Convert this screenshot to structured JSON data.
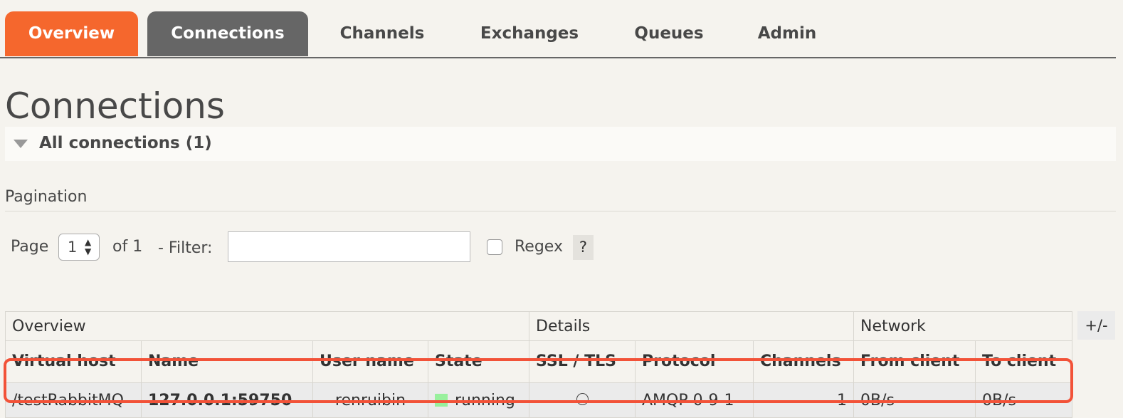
{
  "tabs": [
    "Overview",
    "Connections",
    "Channels",
    "Exchanges",
    "Queues",
    "Admin"
  ],
  "page_title": "Connections",
  "section_title": "All connections (1)",
  "pagination": {
    "label": "Pagination",
    "page_label": "Page",
    "page_value": "1",
    "of_label": "of 1",
    "filter_label": "- Filter:",
    "filter_value": "",
    "regex_label": "Regex",
    "help": "?"
  },
  "table": {
    "groups": [
      "Overview",
      "Details",
      "Network"
    ],
    "headers": [
      "Virtual host",
      "Name",
      "User name",
      "State",
      "SSL / TLS",
      "Protocol",
      "Channels",
      "From client",
      "To client"
    ],
    "rows": [
      {
        "virtual_host": "/testRabbitMQ",
        "name": "127.0.0.1:59750",
        "user_name": "renruibin",
        "state": "running",
        "protocol": "AMQP 0-9-1",
        "channels": "1",
        "from_client": "0B/s",
        "to_client": "0B/s"
      }
    ],
    "plus_minus": "+/-"
  },
  "colors": {
    "accent": "#f5672d",
    "active_tab": "#666666",
    "state_running": "#98f09d",
    "highlight": "#f25238"
  }
}
